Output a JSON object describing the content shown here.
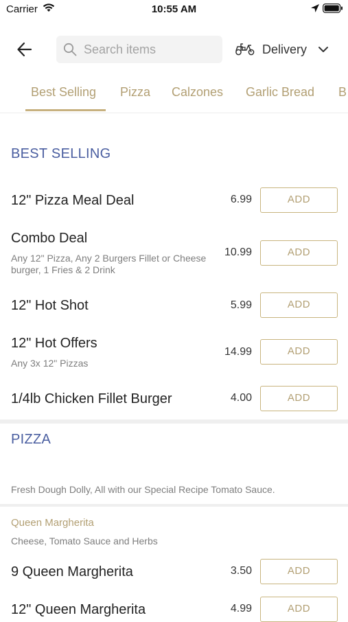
{
  "status_bar": {
    "carrier": "Carrier",
    "time": "10:55 AM"
  },
  "header": {
    "search_placeholder": "Search items",
    "delivery_label": "Delivery"
  },
  "tabs": [
    "Best Selling",
    "Pizza",
    "Calzones",
    "Garlic Bread",
    "B"
  ],
  "sections": {
    "best_selling": {
      "title": "BEST SELLING",
      "items": [
        {
          "name": "12\" Pizza Meal Deal",
          "description": "",
          "price": "6.99",
          "button": "ADD"
        },
        {
          "name": "Combo Deal",
          "description": "Any 12\" Pizza, Any 2 Burgers Fillet or Cheese burger, 1 Fries & 2 Drink",
          "price": "10.99",
          "button": "ADD"
        },
        {
          "name": "12\" Hot Shot",
          "description": "",
          "price": "5.99",
          "button": "ADD"
        },
        {
          "name": "12\" Hot Offers",
          "description": "Any 3x 12\" Pizzas",
          "price": "14.99",
          "button": "ADD"
        },
        {
          "name": "1/4lb Chicken Fillet Burger",
          "description": "",
          "price": "4.00",
          "button": "ADD"
        }
      ]
    },
    "pizza": {
      "title": "PIZZA",
      "description": "Fresh Dough Dolly, All with our Special Recipe Tomato Sauce.",
      "subcategory": {
        "title": "Queen Margherita",
        "description": "Cheese, Tomato Sauce and Herbs",
        "items": [
          {
            "name": "9 Queen Margherita",
            "price": "3.50",
            "button": "ADD"
          },
          {
            "name": "12\" Queen Margherita",
            "price": "4.99",
            "button": "ADD"
          }
        ]
      }
    }
  },
  "colors": {
    "accent": "#b29f73",
    "section_title": "#4a5ea0",
    "divider": "#efefef"
  },
  "icons": [
    "wifi-icon",
    "location-arrow-icon",
    "battery-icon",
    "back-arrow-icon",
    "search-icon",
    "scooter-icon",
    "chevron-down-icon"
  ]
}
